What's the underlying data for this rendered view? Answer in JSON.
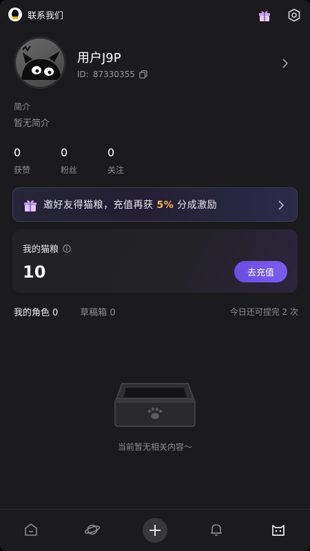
{
  "header": {
    "contact_label": "联系我们",
    "icons": [
      "qq-icon",
      "gift-icon",
      "settings-icon"
    ]
  },
  "profile": {
    "username": "用户J9P",
    "uid_label": "ID:",
    "uid_value": "87330355",
    "bio_title": "简介",
    "bio_text": "暂无简介"
  },
  "stats": [
    {
      "value": "0",
      "label": "获赞"
    },
    {
      "value": "0",
      "label": "粉丝"
    },
    {
      "value": "0",
      "label": "关注"
    }
  ],
  "invite_banner": {
    "text_before": "邀好友得猫粮，充值再获 ",
    "highlight": "5%",
    "text_after": " 分成激励"
  },
  "coins": {
    "title": "我的猫粮",
    "value": "10",
    "recharge_label": "去充值"
  },
  "tabs": [
    {
      "label": "我的角色",
      "count": "0",
      "active": true
    },
    {
      "label": "草稿箱",
      "count": "0",
      "active": false
    }
  ],
  "quota_text": "今日还可捏完 2 次",
  "empty_text": "当前暂无相关内容～",
  "bottom_nav": [
    "home-icon",
    "planet-icon",
    "plus-icon",
    "bell-icon",
    "cat-icon"
  ],
  "colors": {
    "background": "#1b1b1d",
    "accent": "#7b5cf0",
    "highlight": "#f6b35a",
    "muted_text": "#8d8d92"
  }
}
